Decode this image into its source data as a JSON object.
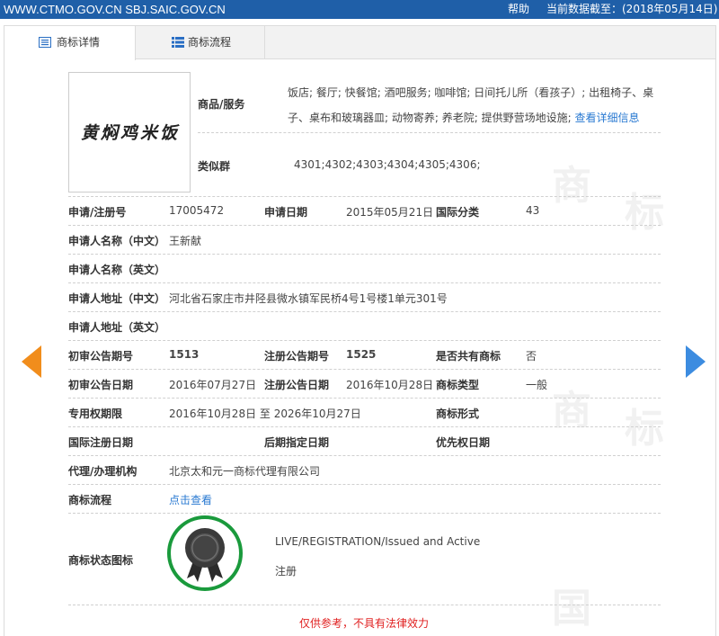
{
  "topbar": {
    "site": "WWW.CTMO.GOV.CN SBJ.SAIC.GOV.CN",
    "help": "帮助",
    "data_date": "当前数据截至：(2018年05月14日)"
  },
  "tabs": [
    {
      "label": "商标详情",
      "icon": "document-list-icon",
      "active": true
    },
    {
      "label": "商标流程",
      "icon": "list-icon",
      "active": false
    }
  ],
  "mark": {
    "image_text": "黄焖鸡米饭",
    "goods_label": "商品/服务",
    "goods_line1": "饭店; 餐厅; 快餐馆; 酒吧服务; 咖啡馆; 日间托儿所（看孩子）; 出租椅子、桌",
    "goods_line2": "子、桌布和玻璃器皿; 动物寄养; 养老院; 提供野营场地设施;",
    "goods_link": "查看详细信息",
    "similar_label": "类似群",
    "similar_value": "4301;4302;4303;4304;4305;4306;"
  },
  "fields": {
    "reg_no_label": "申请/注册号",
    "reg_no": "17005472",
    "apply_date_label": "申请日期",
    "apply_date": "2015年05月21日",
    "intl_class_label": "国际分类",
    "intl_class": "43",
    "applicant_cn_label": "申请人名称（中文）",
    "applicant_cn": "王新献",
    "applicant_en_label": "申请人名称（英文）",
    "applicant_en": "",
    "address_cn_label": "申请人地址（中文）",
    "address_cn": "河北省石家庄市井陉县微水镇军民桥4号1号楼1单元301号",
    "address_en_label": "申请人地址（英文）",
    "address_en": "",
    "prelim_no_label": "初审公告期号",
    "prelim_no": "1513",
    "reg_pub_no_label": "注册公告期号",
    "reg_pub_no": "1525",
    "shared_label": "是否共有商标",
    "shared": "否",
    "prelim_date_label": "初审公告日期",
    "prelim_date": "2016年07月27日",
    "reg_pub_date_label": "注册公告日期",
    "reg_pub_date": "2016年10月28日",
    "mark_type_label": "商标类型",
    "mark_type": "一般",
    "exclusive_label": "专用权期限",
    "exclusive": "2016年10月28日 至 2026年10月27日",
    "mark_form_label": "商标形式",
    "mark_form": "",
    "intl_reg_date_label": "国际注册日期",
    "intl_reg_date": "",
    "later_date_label": "后期指定日期",
    "later_date": "",
    "priority_date_label": "优先权日期",
    "priority_date": "",
    "agent_label": "代理/办理机构",
    "agent": "北京太和元一商标代理有限公司",
    "flow_label": "商标流程",
    "flow_link": "点击查看",
    "status_label": "商标状态图标",
    "status_en": "LIVE/REGISTRATION/Issued and Active",
    "status_cn": "注册"
  },
  "notice": "仅供参考，不具有法律效力",
  "colors": {
    "topbar": "#1f5fa8",
    "link": "#2a7ad2",
    "prev_arrow": "#f18d1c",
    "next_arrow": "#3c8ce0",
    "badge_ring": "#1a9a3c",
    "notice": "#e02020"
  }
}
